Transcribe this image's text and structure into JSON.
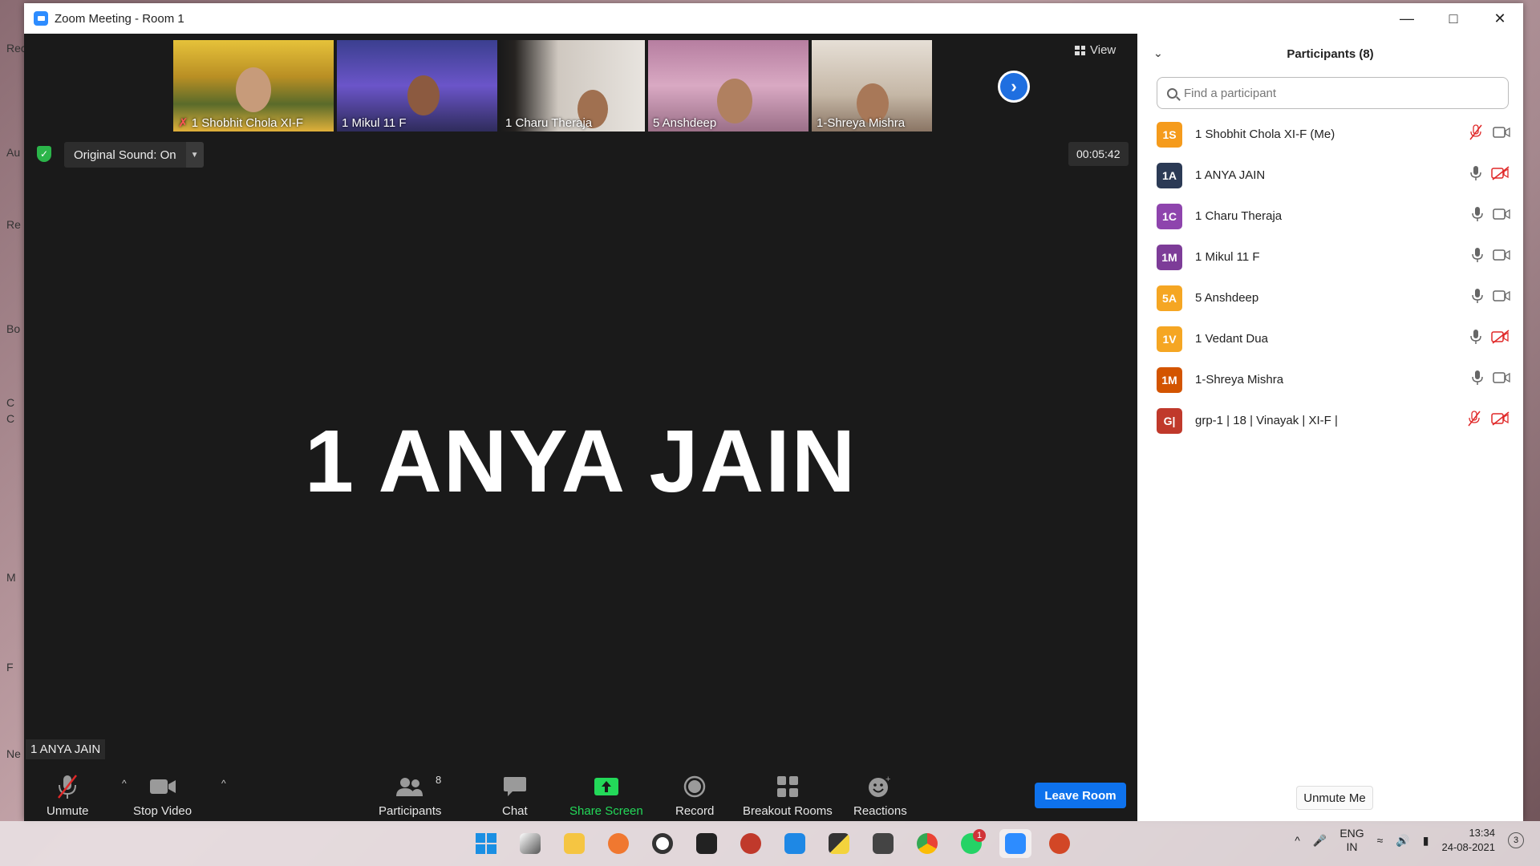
{
  "window": {
    "title": "Zoom Meeting - Room 1"
  },
  "desktop": {
    "labels": [
      "Rec",
      "Au",
      "Re",
      "Bo",
      "C",
      "C",
      "M",
      "F",
      "Ne"
    ]
  },
  "thumbnails": [
    {
      "name": "1 Shobhit Chola XI-F",
      "muted": true
    },
    {
      "name": "1 Mikul 11 F",
      "muted": false
    },
    {
      "name": "1 Charu Theraja",
      "muted": false
    },
    {
      "name": "5 Anshdeep",
      "muted": false
    },
    {
      "name": "1-Shreya Mishra",
      "muted": false
    }
  ],
  "stage": {
    "view_label": "View",
    "original_sound": "Original Sound: On",
    "timer": "00:05:42",
    "active_speaker": "1 ANYA JAIN",
    "speaker_tag": "1 ANYA JAIN"
  },
  "toolbar": {
    "unmute": "Unmute",
    "stop_video": "Stop Video",
    "participants": "Participants",
    "participants_count": "8",
    "chat": "Chat",
    "share_screen": "Share Screen",
    "record": "Record",
    "breakout_rooms": "Breakout Rooms",
    "reactions": "Reactions",
    "leave": "Leave Room",
    "share_color": "#23d959"
  },
  "panel": {
    "title": "Participants (8)",
    "search_placeholder": "Find a participant",
    "unmute_me": "Unmute Me",
    "participants": [
      {
        "initials": "1S",
        "name": "1 Shobhit Chola XI-F (Me)",
        "color": "#f59b1c",
        "mic": "muted",
        "video": "on"
      },
      {
        "initials": "1A",
        "name": "1 ANYA JAIN",
        "color": "#2b3a55",
        "mic": "on",
        "video": "off"
      },
      {
        "initials": "1C",
        "name": "1 Charu Theraja",
        "color": "#8e44ad",
        "mic": "on",
        "video": "on"
      },
      {
        "initials": "1M",
        "name": "1 Mikul 11 F",
        "color": "#7d3c98",
        "mic": "on",
        "video": "on"
      },
      {
        "initials": "5A",
        "name": "5 Anshdeep",
        "color": "#f5a623",
        "mic": "on",
        "video": "on"
      },
      {
        "initials": "1V",
        "name": "1 Vedant Dua",
        "color": "#f5a623",
        "mic": "on",
        "video": "off"
      },
      {
        "initials": "1M",
        "name": "1-Shreya Mishra",
        "color": "#d35400",
        "mic": "on",
        "video": "on"
      },
      {
        "initials": "G|",
        "name": "grp-1 | 18 | Vinayak | XI-F |",
        "color": "#c0392b",
        "mic": "muted",
        "video": "off"
      }
    ]
  },
  "taskbar": {
    "whatsapp_badge": "1",
    "lang_line1": "ENG",
    "lang_line2": "IN",
    "time": "13:34",
    "date": "24-08-2021",
    "notifications": "3"
  }
}
